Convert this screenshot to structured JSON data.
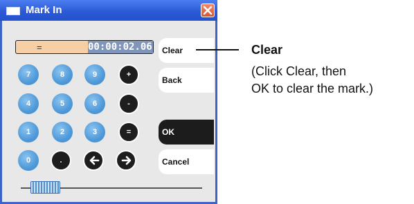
{
  "window": {
    "title": "Mark In"
  },
  "display": {
    "prefix": "=",
    "time": "00:00:02.06"
  },
  "keypad": {
    "keys": [
      {
        "label": "7",
        "kind": "num"
      },
      {
        "label": "8",
        "kind": "num"
      },
      {
        "label": "9",
        "kind": "num"
      },
      {
        "label": "+",
        "kind": "dark"
      },
      {
        "label": "4",
        "kind": "num"
      },
      {
        "label": "5",
        "kind": "num"
      },
      {
        "label": "6",
        "kind": "num"
      },
      {
        "label": "-",
        "kind": "dark"
      },
      {
        "label": "1",
        "kind": "num"
      },
      {
        "label": "2",
        "kind": "num"
      },
      {
        "label": "3",
        "kind": "num"
      },
      {
        "label": "=",
        "kind": "dark"
      },
      {
        "label": "0",
        "kind": "num"
      },
      {
        "label": ".",
        "kind": "dark"
      },
      {
        "label": "",
        "kind": "dark",
        "icon": "arrow-left-icon"
      },
      {
        "label": "",
        "kind": "dark",
        "icon": "arrow-right-icon"
      }
    ]
  },
  "buttons": {
    "clear": "Clear",
    "back": "Back",
    "ok": "OK",
    "cancel": "Cancel"
  },
  "callout": {
    "title": "Clear",
    "lines": [
      "(Click Clear, then",
      "OK to clear the mark.)"
    ]
  }
}
